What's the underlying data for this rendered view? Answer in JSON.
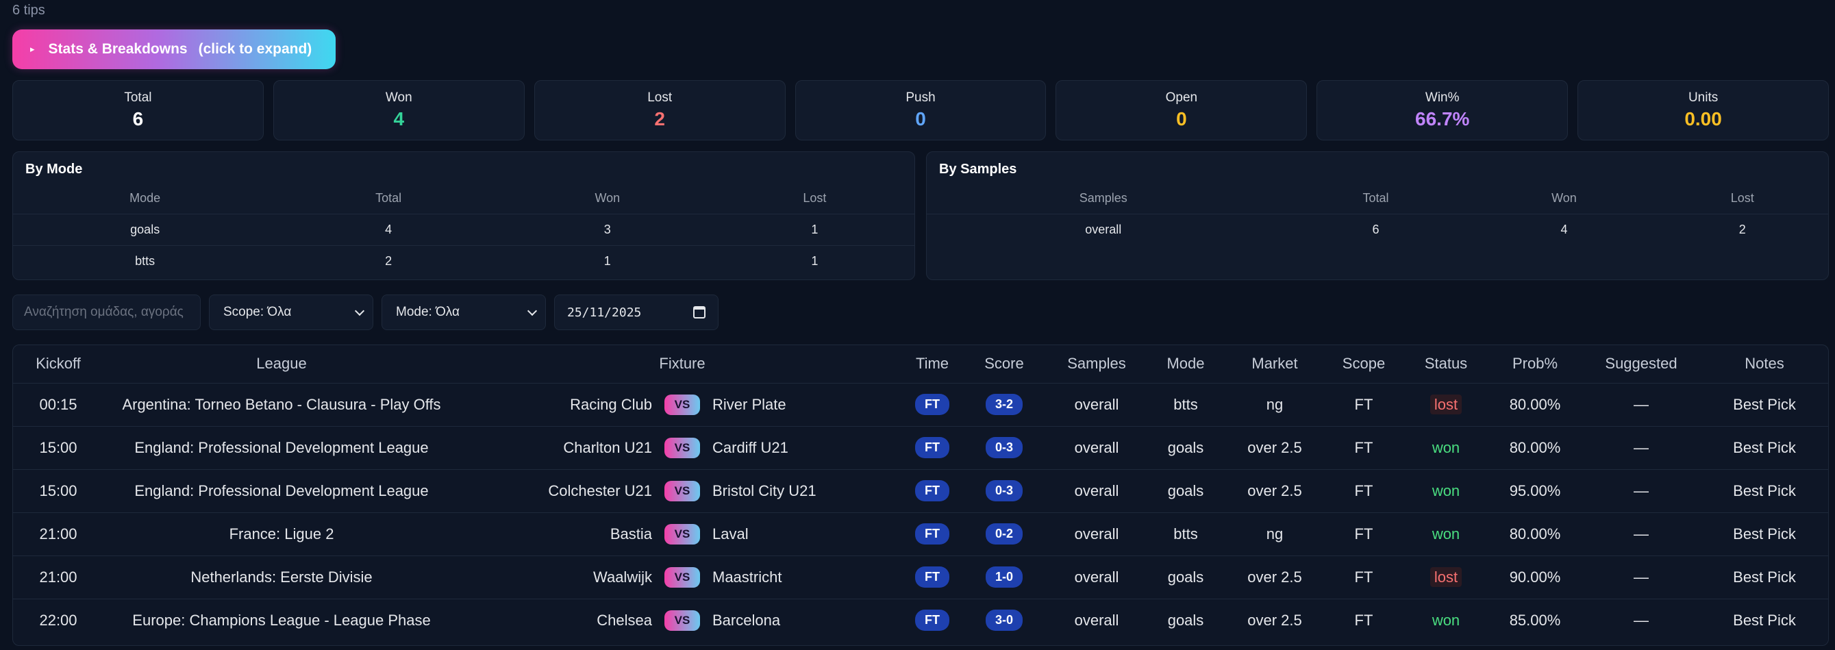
{
  "header": {
    "tips_count": "6 tips",
    "expand_arrow": "▸",
    "expand_label": "Stats & Breakdowns",
    "expand_hint": "(click to expand)"
  },
  "stats": [
    {
      "label": "Total",
      "value": "6",
      "color": "#ffffff"
    },
    {
      "label": "Won",
      "value": "4",
      "color": "#34d399"
    },
    {
      "label": "Lost",
      "value": "2",
      "color": "#f87171"
    },
    {
      "label": "Push",
      "value": "0",
      "color": "#60a5fa"
    },
    {
      "label": "Open",
      "value": "0",
      "color": "#fbbf24"
    },
    {
      "label": "Win%",
      "value": "66.7%",
      "color": "#c084fc"
    },
    {
      "label": "Units",
      "value": "0.00",
      "color": "#fbbf24"
    }
  ],
  "by_mode": {
    "title": "By Mode",
    "headers": [
      "Mode",
      "Total",
      "Won",
      "Lost"
    ],
    "rows": [
      [
        "goals",
        "4",
        "3",
        "1"
      ],
      [
        "btts",
        "2",
        "1",
        "1"
      ]
    ]
  },
  "by_samples": {
    "title": "By Samples",
    "headers": [
      "Samples",
      "Total",
      "Won",
      "Lost"
    ],
    "rows": [
      [
        "overall",
        "6",
        "4",
        "2"
      ]
    ]
  },
  "filters": {
    "search_placeholder": "Αναζήτηση ομάδας, αγοράς",
    "scope": "Scope: Όλα",
    "mode": "Mode: Όλα",
    "date": "25/11/2025"
  },
  "table": {
    "headers": [
      "Kickoff",
      "League",
      "Fixture",
      "Time",
      "Score",
      "Samples",
      "Mode",
      "Market",
      "Scope",
      "Status",
      "Prob%",
      "Suggested",
      "Notes"
    ],
    "vs_label": "VS",
    "rows": [
      {
        "kickoff": "00:15",
        "league": "Argentina: Torneo Betano - Clausura - Play Offs",
        "home": "Racing Club",
        "away": "River Plate",
        "time": "FT",
        "score": "3-2",
        "samples": "overall",
        "mode": "btts",
        "market": "ng",
        "scope": "FT",
        "status": "lost",
        "prob": "80.00%",
        "suggested": "—",
        "notes": "Best Pick"
      },
      {
        "kickoff": "15:00",
        "league": "England: Professional Development League",
        "home": "Charlton U21",
        "away": "Cardiff U21",
        "time": "FT",
        "score": "0-3",
        "samples": "overall",
        "mode": "goals",
        "market": "over 2.5",
        "scope": "FT",
        "status": "won",
        "prob": "80.00%",
        "suggested": "—",
        "notes": "Best Pick"
      },
      {
        "kickoff": "15:00",
        "league": "England: Professional Development League",
        "home": "Colchester U21",
        "away": "Bristol City U21",
        "time": "FT",
        "score": "0-3",
        "samples": "overall",
        "mode": "goals",
        "market": "over 2.5",
        "scope": "FT",
        "status": "won",
        "prob": "95.00%",
        "suggested": "—",
        "notes": "Best Pick"
      },
      {
        "kickoff": "21:00",
        "league": "France: Ligue 2",
        "home": "Bastia",
        "away": "Laval",
        "time": "FT",
        "score": "0-2",
        "samples": "overall",
        "mode": "btts",
        "market": "ng",
        "scope": "FT",
        "status": "won",
        "prob": "80.00%",
        "suggested": "—",
        "notes": "Best Pick"
      },
      {
        "kickoff": "21:00",
        "league": "Netherlands: Eerste Divisie",
        "home": "Waalwijk",
        "away": "Maastricht",
        "time": "FT",
        "score": "1-0",
        "samples": "overall",
        "mode": "goals",
        "market": "over 2.5",
        "scope": "FT",
        "status": "lost",
        "prob": "90.00%",
        "suggested": "—",
        "notes": "Best Pick"
      },
      {
        "kickoff": "22:00",
        "league": "Europe: Champions League - League Phase",
        "home": "Chelsea",
        "away": "Barcelona",
        "time": "FT",
        "score": "3-0",
        "samples": "overall",
        "mode": "goals",
        "market": "over 2.5",
        "scope": "FT",
        "status": "won",
        "prob": "85.00%",
        "suggested": "—",
        "notes": "Best Pick"
      }
    ]
  }
}
